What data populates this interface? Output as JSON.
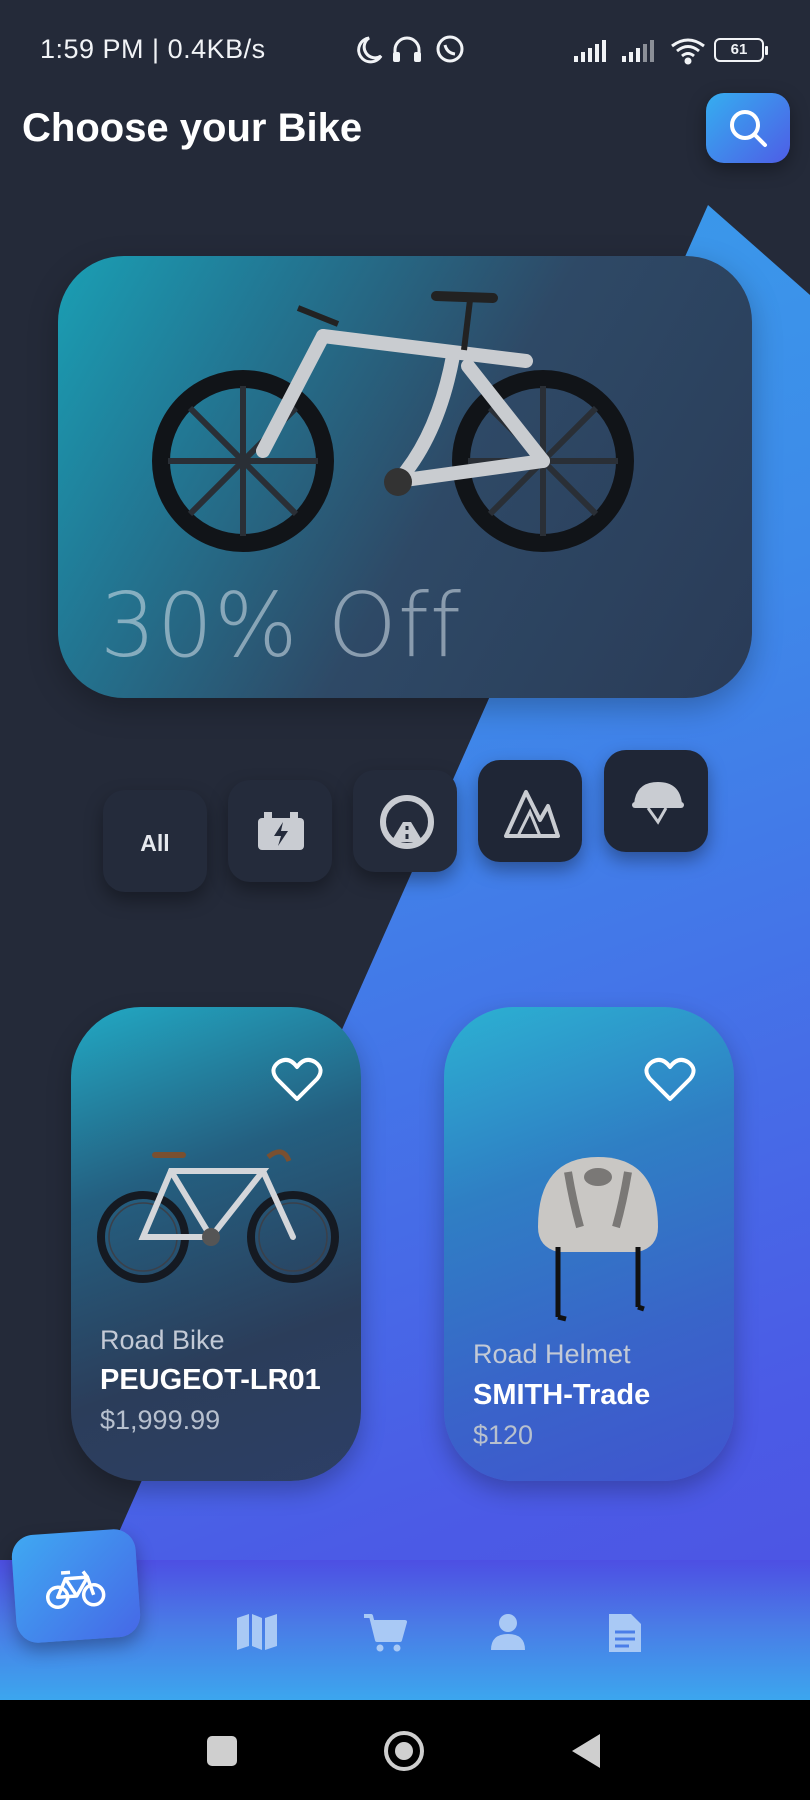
{
  "status_bar": {
    "text": "1:59 PM | 0.4KB/s",
    "battery": "61",
    "icons": [
      "moon-icon",
      "headphones-icon",
      "whatsapp-icon",
      "signal-icon",
      "signal-icon",
      "wifi-icon",
      "battery-icon"
    ]
  },
  "header": {
    "title": "Choose your Bike",
    "search_icon": "search-icon"
  },
  "hero": {
    "discount": "30% Off",
    "image": "electric-bike-image"
  },
  "categories": [
    {
      "label": "All",
      "icon": null
    },
    {
      "label": "",
      "icon": "battery-bolt-icon"
    },
    {
      "label": "",
      "icon": "road-icon"
    },
    {
      "label": "",
      "icon": "mountain-icon"
    },
    {
      "label": "",
      "icon": "helmet-icon"
    }
  ],
  "products": [
    {
      "category": "Road Bike",
      "name": "PEUGEOT-LR01",
      "price": "$1,999.99",
      "icon": "heart-icon"
    },
    {
      "category": "Road Helmet",
      "name": "SMITH-Trade",
      "price": "$120",
      "icon": "heart-icon"
    }
  ],
  "bottom_nav": {
    "items": [
      "bike-icon",
      "map-icon",
      "cart-icon",
      "user-icon",
      "document-icon"
    ],
    "active": "bike-icon"
  },
  "colors": {
    "background": "#242a39",
    "accent_blue": "#3ea8ef",
    "accent_indigo": "#4d4fe1"
  }
}
